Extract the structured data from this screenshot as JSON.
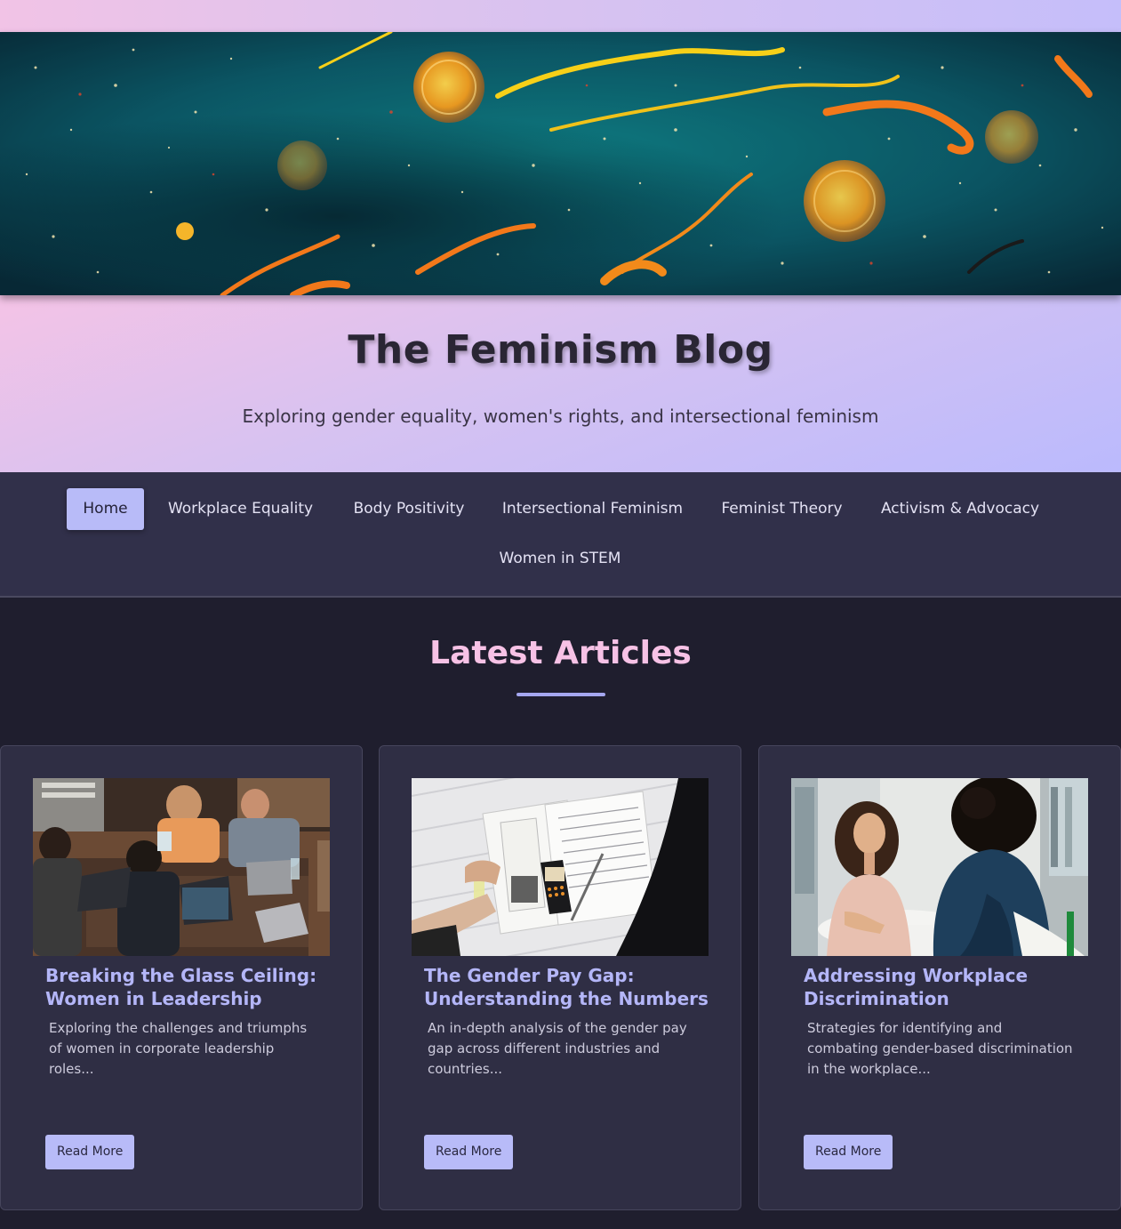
{
  "header": {
    "title": "The Feminism Blog",
    "tagline": "Exploring gender equality, women's rights, and intersectional feminism"
  },
  "nav": {
    "items": [
      {
        "label": "Home",
        "active": true
      },
      {
        "label": "Workplace Equality",
        "active": false
      },
      {
        "label": "Body Positivity",
        "active": false
      },
      {
        "label": "Intersectional Feminism",
        "active": false
      },
      {
        "label": "Feminist Theory",
        "active": false
      },
      {
        "label": "Activism & Advocacy",
        "active": false
      },
      {
        "label": "Women in STEM",
        "active": false
      }
    ]
  },
  "main": {
    "section_title": "Latest Articles",
    "articles": [
      {
        "title": "Breaking the Glass Ceiling: Women in Leadership",
        "excerpt": "Exploring the challenges and triumphs of women in corporate leadership roles...",
        "button_label": "Read More",
        "image": "team-meeting-photo"
      },
      {
        "title": "The Gender Pay Gap: Understanding the Numbers",
        "excerpt": "An in-depth analysis of the gender pay gap across different industries and countries...",
        "button_label": "Read More",
        "image": "tax-documents-calculator-photo"
      },
      {
        "title": "Addressing Workplace Discrimination",
        "excerpt": "Strategies for identifying and combating gender-based discrimination in the workplace...",
        "button_label": "Read More",
        "image": "two-women-conversation-photo"
      }
    ]
  },
  "colors": {
    "accent": "#b8bbf8",
    "heading_pink": "#f7c2e6",
    "nav_bg": "#31304a",
    "page_bg": "#1f1e2e",
    "card_bg": "#2f2e44"
  }
}
